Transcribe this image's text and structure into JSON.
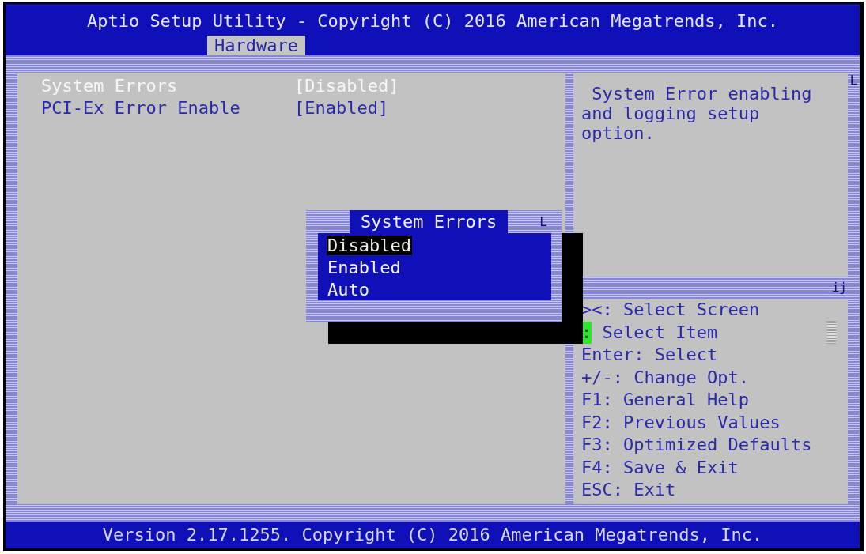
{
  "window": {
    "title": "Aptio Setup Utility - Copyright (C) 2016 American Megatrends, Inc."
  },
  "tabs": [
    {
      "label": "Hardware",
      "selected": true
    }
  ],
  "frame": {
    "corner_glyph": "L"
  },
  "settings": [
    {
      "label": "System Errors",
      "value": "[Disabled]",
      "selected": true
    },
    {
      "label": "PCI-Ex Error Enable",
      "value": "[Enabled]",
      "selected": false
    }
  ],
  "popup": {
    "title": "System Errors",
    "corner_glyph": "L",
    "options": [
      {
        "label": "Disabled",
        "selected": true
      },
      {
        "label": "Enabled",
        "selected": false
      },
      {
        "label": "Auto",
        "selected": false
      }
    ]
  },
  "help": {
    "text": "System Error enabling and logging setup option.",
    "divider_glyph": "ij"
  },
  "key_legend": [
    {
      "key": "><:",
      "action": "Select Screen",
      "highlighted": false
    },
    {
      "key": ":",
      "action": "Select Item",
      "highlighted": true
    },
    {
      "key": "Enter:",
      "action": "Select",
      "highlighted": false
    },
    {
      "key": "+/-:",
      "action": "Change Opt.",
      "highlighted": false
    },
    {
      "key": "F1:",
      "action": "General Help",
      "highlighted": false
    },
    {
      "key": "F2:",
      "action": "Previous Values",
      "highlighted": false
    },
    {
      "key": "F3:",
      "action": "Optimized Defaults",
      "highlighted": false
    },
    {
      "key": "F4:",
      "action": "Save & Exit",
      "highlighted": false
    },
    {
      "key": "ESC:",
      "action": "Exit",
      "highlighted": false
    }
  ],
  "status_bar": {
    "text": "Version 2.17.1255. Copyright (C) 2016 American Megatrends, Inc."
  }
}
